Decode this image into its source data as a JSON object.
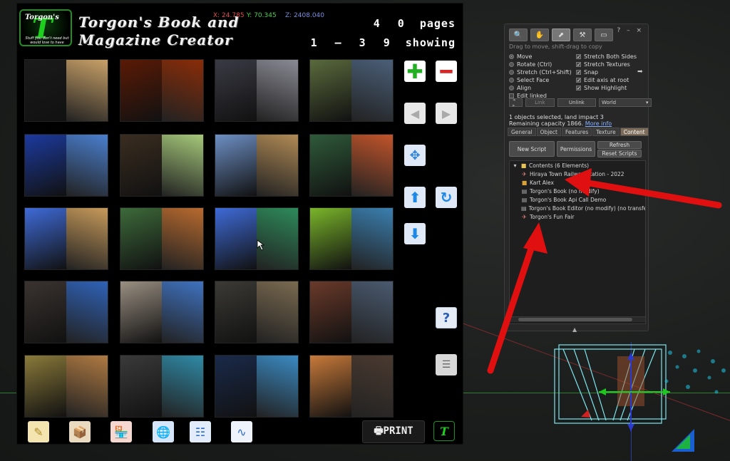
{
  "hud": {
    "logo_name": "Torgon's",
    "logo_tagline": "Stuff you don't need but would love to have",
    "logo_letter": "T",
    "title_line1": "Torgon's Book and",
    "title_line2": "Magazine Creator",
    "coord_x": "X: 24.785",
    "coord_y": "Y: 70.345",
    "coord_z": "Z: 2408.040",
    "pages_count": "4 0",
    "pages_label": "pages",
    "range": "1 – 3 9",
    "range_label": "showing",
    "print_label": "🖶PRINT",
    "mini_logo": "T"
  },
  "thumbnails": [
    {
      "l": "#1a1a1a",
      "r": "#c9a168"
    },
    {
      "l": "#5a1a05",
      "r": "#8a2c08"
    },
    {
      "l": "#3a3a44",
      "r": "#8a8a94"
    },
    {
      "l": "#5a6a3c",
      "r": "#4a5f78"
    },
    {
      "l": "#1c3a9e",
      "r": "#4a7fcf"
    },
    {
      "l": "#3a2d20",
      "r": "#a6c97a"
    },
    {
      "l": "#6d8fc4",
      "r": "#b08a55"
    },
    {
      "l": "#2f5a3a",
      "r": "#c2542a"
    },
    {
      "l": "#3f6bd8",
      "r": "#c79a5a"
    },
    {
      "l": "#3d6a3a",
      "r": "#b86a2e"
    },
    {
      "l": "#3f6bd8",
      "r": "#2d8a5a"
    },
    {
      "l": "#7ab52a",
      "r": "#3a7fb0"
    },
    {
      "l": "#3a3330",
      "r": "#2f62b8"
    },
    {
      "l": "#9a8f82",
      "r": "#3f72c0"
    },
    {
      "l": "#3b3a35",
      "r": "#7a6a50"
    },
    {
      "l": "#6a3a2a",
      "r": "#4a5a70"
    },
    {
      "l": "#8a7a3a",
      "r": "#b07a42"
    },
    {
      "l": "#3a3a3a",
      "r": "#2f8aa6"
    },
    {
      "l": "#1a2a4a",
      "r": "#3a8ac2"
    },
    {
      "l": "#c87a3a",
      "r": "#4a3a30"
    }
  ],
  "side_buttons": {
    "plus": "✚",
    "minus": "━",
    "prev": "◀",
    "next": "▶",
    "expand": "✥",
    "up": "⬆",
    "rotate": "↻",
    "down": "⬇",
    "help": "?",
    "list": "☰"
  },
  "bottom_icons": [
    "✎",
    "📦",
    "🏪",
    "🌐",
    "☷",
    "∿"
  ],
  "floater": {
    "tools": [
      "🔍",
      "✋",
      "⬈",
      "⚒",
      "▭"
    ],
    "win_ctrls": "? – ×",
    "hint": "Drag to move, shift-drag to copy",
    "modes": [
      {
        "label": "Move",
        "on": true
      },
      {
        "label": "Rotate (Ctrl)",
        "on": false
      },
      {
        "label": "Stretch (Ctrl+Shift)",
        "on": false
      },
      {
        "label": "Select Face",
        "on": false
      },
      {
        "label": "Align",
        "on": false
      },
      {
        "label": "Edit linked",
        "on": false,
        "checkbox": true
      }
    ],
    "options": [
      {
        "label": "Stretch Both Sides",
        "on": true
      },
      {
        "label": "Stretch Textures",
        "on": true
      },
      {
        "label": "Snap",
        "on": true
      },
      {
        "label": "Edit axis at root",
        "on": true
      },
      {
        "label": "Show Highlight",
        "on": true
      }
    ],
    "arrow_glyph": "➡",
    "link_label": "Link",
    "unlink_label": "Unlink",
    "link_arrows": "◂ ▸",
    "ruler_value": "World",
    "select_caret": "▾",
    "selection_line1": "1 objects selected, land impact 3",
    "selection_line2": "Remaining capacity 1866.",
    "more_info": "More info",
    "tabs": [
      "General",
      "Object",
      "Features",
      "Texture",
      "Content"
    ],
    "active_tab": "Content",
    "new_script": "New Script",
    "permissions": "Permissions",
    "refresh": "Refresh",
    "reset_scripts": "Reset Scripts",
    "contents_folder": "Contents (6 Elements)",
    "contents": [
      {
        "name": "Hiraya Town Railway Station - 2022",
        "type": "land"
      },
      {
        "name": "Kart Alex",
        "type": "obj"
      },
      {
        "name": "Torgon's Book (no modify)",
        "type": "script"
      },
      {
        "name": "Torgon's Book Api Call Demo",
        "type": "script"
      },
      {
        "name": "Torgon's Book Editor (no modify) (no transfer)",
        "type": "script"
      },
      {
        "name": "Torgon's Fun Fair",
        "type": "land"
      }
    ]
  },
  "colors": {
    "accent_green": "#1ed01e",
    "arrow_red": "#e01010",
    "tab_active": "#7d6c5a"
  }
}
